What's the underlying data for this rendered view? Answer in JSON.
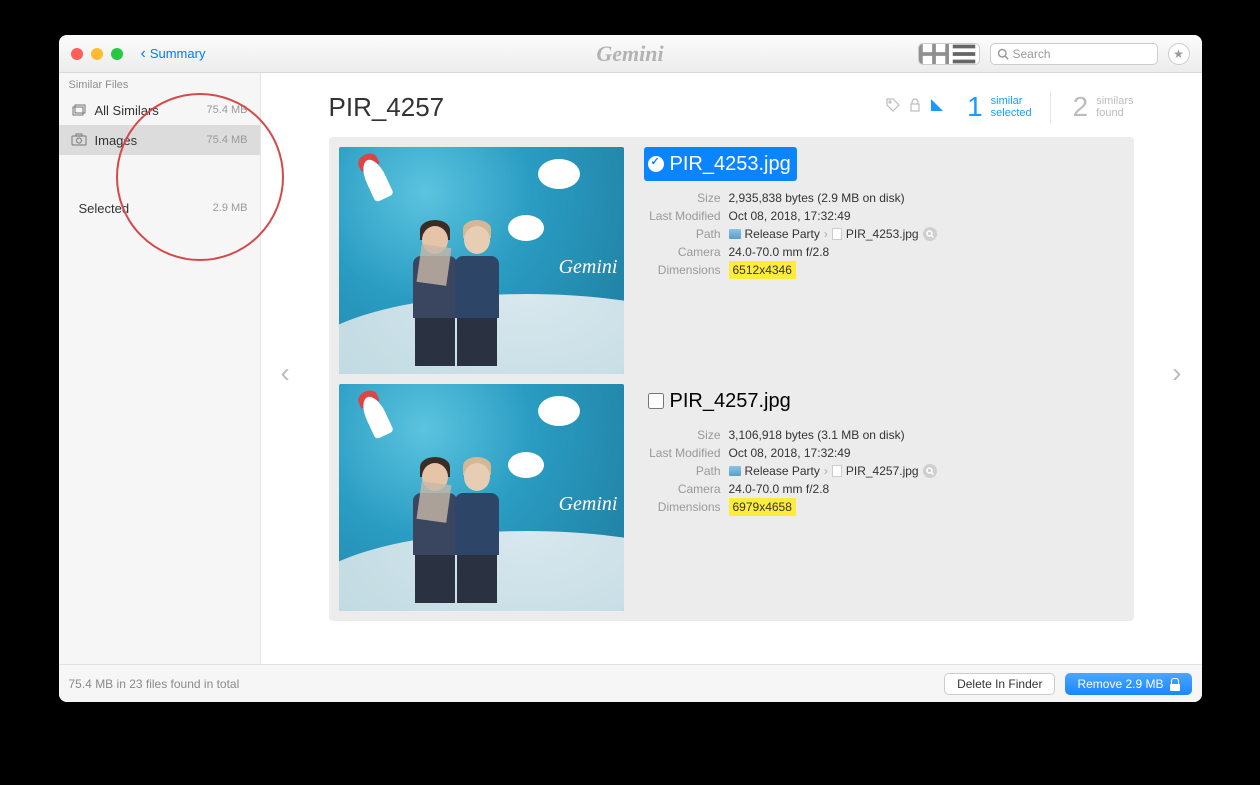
{
  "titlebar": {
    "back_label": "Summary",
    "app_logo": "Gemini",
    "search_placeholder": "Search"
  },
  "sidebar": {
    "header": "Similar Files",
    "items": [
      {
        "label": "All Similars",
        "size": "75.4 MB"
      },
      {
        "label": "Images",
        "size": "75.4 MB"
      }
    ],
    "selected": {
      "label": "Selected",
      "size": "2.9 MB"
    }
  },
  "content": {
    "title": "PIR_4257",
    "stats": {
      "selected_count": "1",
      "selected_label_1": "similar",
      "selected_label_2": "selected",
      "found_count": "2",
      "found_label_1": "similars",
      "found_label_2": "found"
    },
    "meta_labels": {
      "size": "Size",
      "modified": "Last Modified",
      "path": "Path",
      "camera": "Camera",
      "dimensions": "Dimensions"
    },
    "files": [
      {
        "name": "PIR_4253.jpg",
        "checked": true,
        "size": "2,935,838 bytes (2.9 MB on disk)",
        "modified": "Oct 08, 2018, 17:32:49",
        "path_folder": "Release Party",
        "path_file": "PIR_4253.jpg",
        "camera": "24.0-70.0 mm f/2.8",
        "dimensions": "6512x4346"
      },
      {
        "name": "PIR_4257.jpg",
        "checked": false,
        "size": "3,106,918 bytes (3.1 MB on disk)",
        "modified": "Oct 08, 2018, 17:32:49",
        "path_folder": "Release Party",
        "path_file": "PIR_4257.jpg",
        "camera": "24.0-70.0 mm f/2.8",
        "dimensions": "6979x4658"
      }
    ]
  },
  "footer": {
    "status": "75.4 MB in 23 files found in total",
    "delete_label": "Delete In Finder",
    "remove_label": "Remove 2.9 MB"
  }
}
